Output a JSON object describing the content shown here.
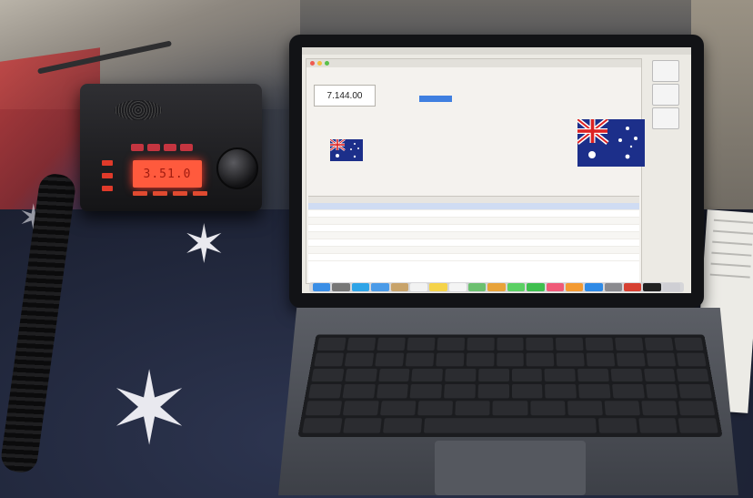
{
  "scene": {
    "colors": {
      "radio_display": "#ff5a3d",
      "radio_buttons": "#c43540",
      "app_accent": "#3f7fe0",
      "table": "#20263a"
    }
  },
  "radio": {
    "display_text": "3.51.0"
  },
  "screen": {
    "menubar": {
      "apple": "",
      "clock": ""
    },
    "app": {
      "title": "",
      "frequency": "7.144.00",
      "country_small": "",
      "country_big": "",
      "tabs": [],
      "callsign": "",
      "log_columns": [],
      "log_rows": []
    },
    "desktop_icons": [
      {
        "label": ""
      },
      {
        "label": ""
      },
      {
        "label": ""
      }
    ]
  }
}
